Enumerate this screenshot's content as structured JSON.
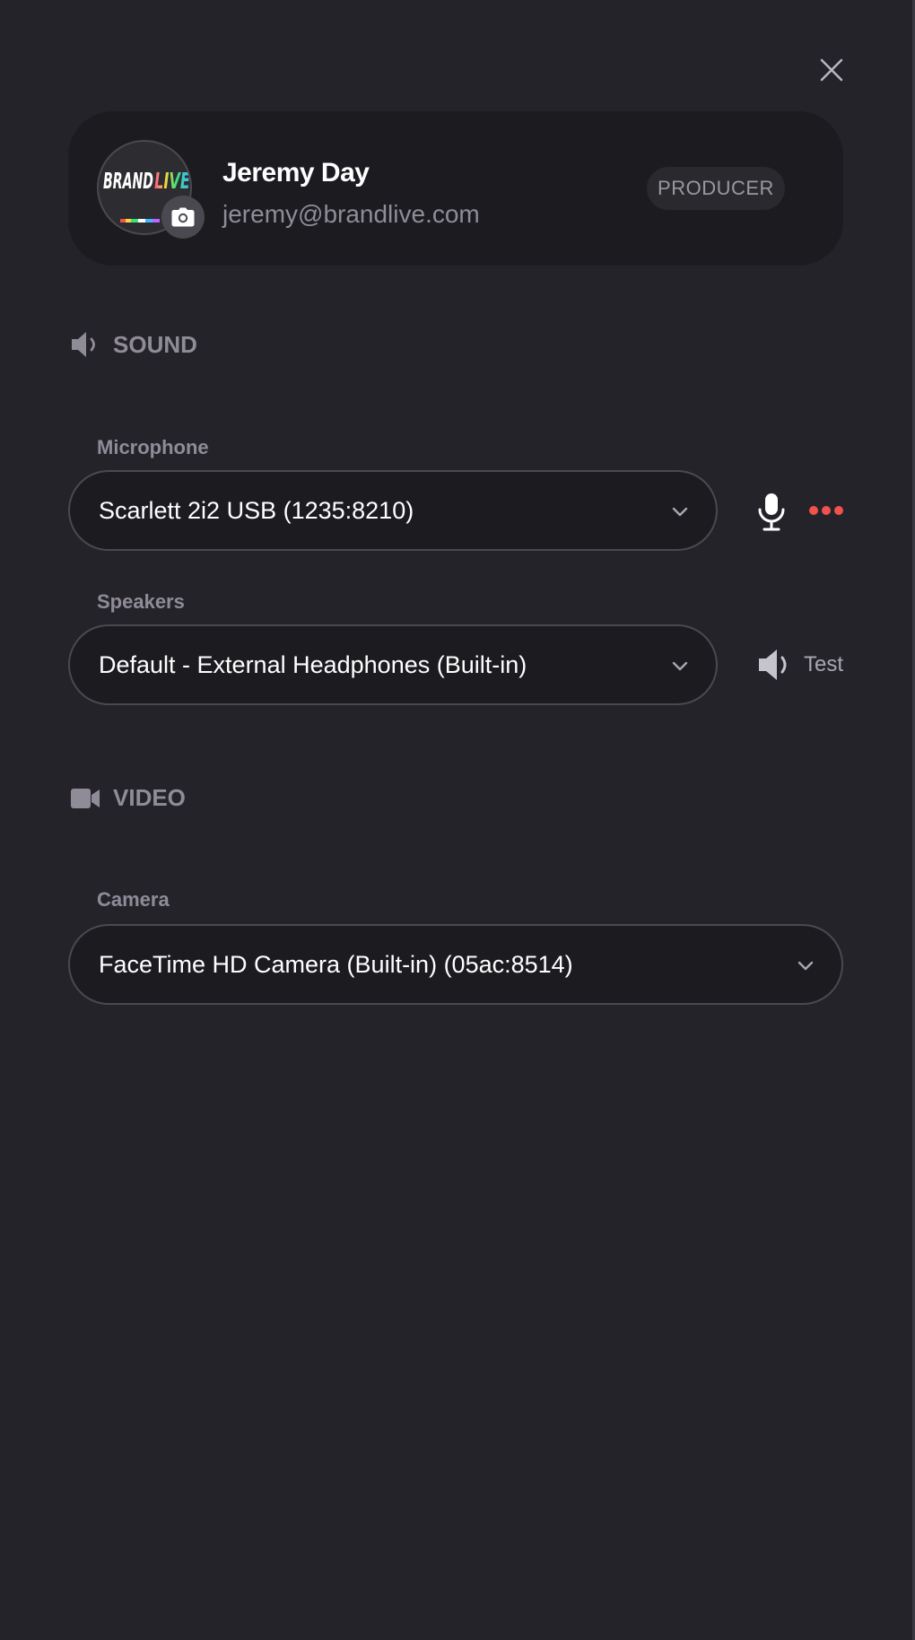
{
  "profile": {
    "name": "Jeremy Day",
    "email": "jeremy@brandlive.com",
    "role": "PRODUCER",
    "avatar_logo": "BRANDLIVE"
  },
  "sound": {
    "title": "SOUND",
    "icon": "speaker-icon",
    "microphone": {
      "label": "Microphone",
      "value": "Scarlett 2i2 USB (1235:8210)"
    },
    "speakers": {
      "label": "Speakers",
      "value": "Default - External Headphones (Built-in)",
      "test_label": "Test"
    }
  },
  "video": {
    "title": "VIDEO",
    "icon": "video-camera-icon",
    "camera": {
      "label": "Camera",
      "value": "FaceTime HD Camera (Built-in) (05ac:8514)"
    }
  },
  "colors": {
    "background": "#25232a",
    "card": "#1c1b20",
    "muted_text": "#8f8c98",
    "mic_level_indicator": "#f0524d"
  }
}
